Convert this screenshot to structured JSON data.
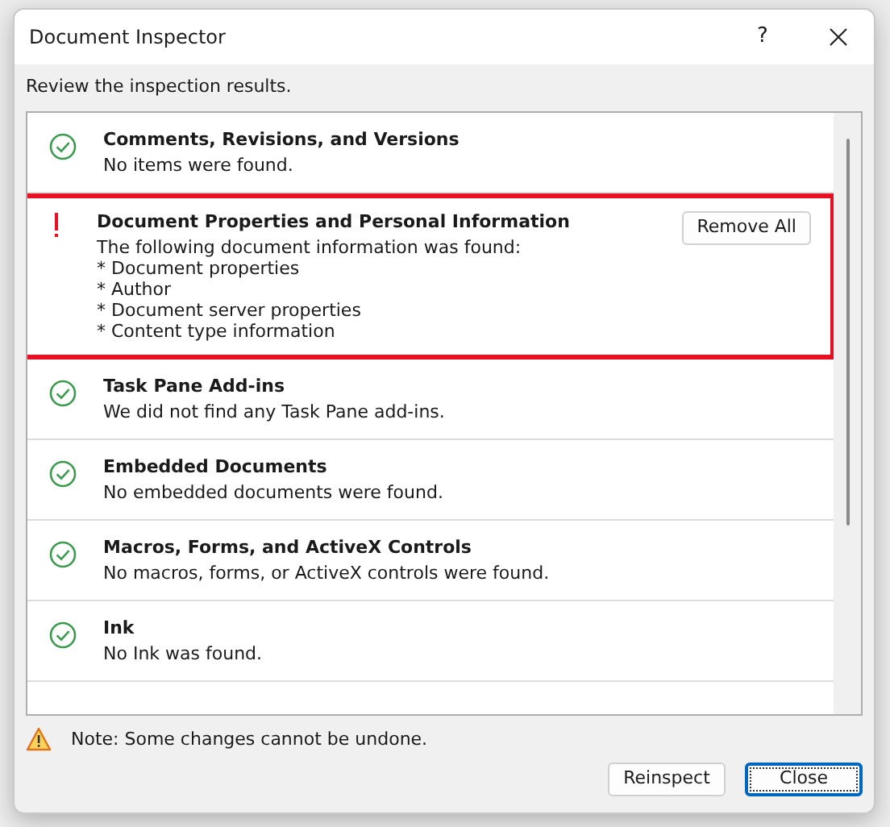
{
  "window": {
    "title": "Document Inspector",
    "help": "?"
  },
  "instructions": "Review the inspection results.",
  "results": [
    {
      "kind": "ok",
      "title": "Comments, Revisions, and Versions",
      "lines": [
        "No items were found."
      ],
      "highlighted": false
    },
    {
      "kind": "warning",
      "title": "Document Properties and Personal Information",
      "lines": [
        "The following document information was found:",
        "* Document properties",
        "* Author",
        "* Document server properties",
        "* Content type information"
      ],
      "button": "Remove All",
      "highlighted": true
    },
    {
      "kind": "ok",
      "title": "Task Pane Add-ins",
      "lines": [
        "We did not find any Task Pane add-ins."
      ],
      "highlighted": false
    },
    {
      "kind": "ok",
      "title": "Embedded Documents",
      "lines": [
        "No embedded documents were found."
      ],
      "highlighted": false
    },
    {
      "kind": "ok",
      "title": "Macros, Forms, and ActiveX Controls",
      "lines": [
        "No macros, forms, or ActiveX controls were found."
      ],
      "highlighted": false
    },
    {
      "kind": "ok",
      "title": "Ink",
      "lines": [
        "No Ink was found."
      ],
      "highlighted": false
    }
  ],
  "note": "Note: Some changes cannot be undone.",
  "buttons": [
    {
      "label": "Reinspect",
      "focused": false
    },
    {
      "label": "Close",
      "focused": true
    }
  ]
}
